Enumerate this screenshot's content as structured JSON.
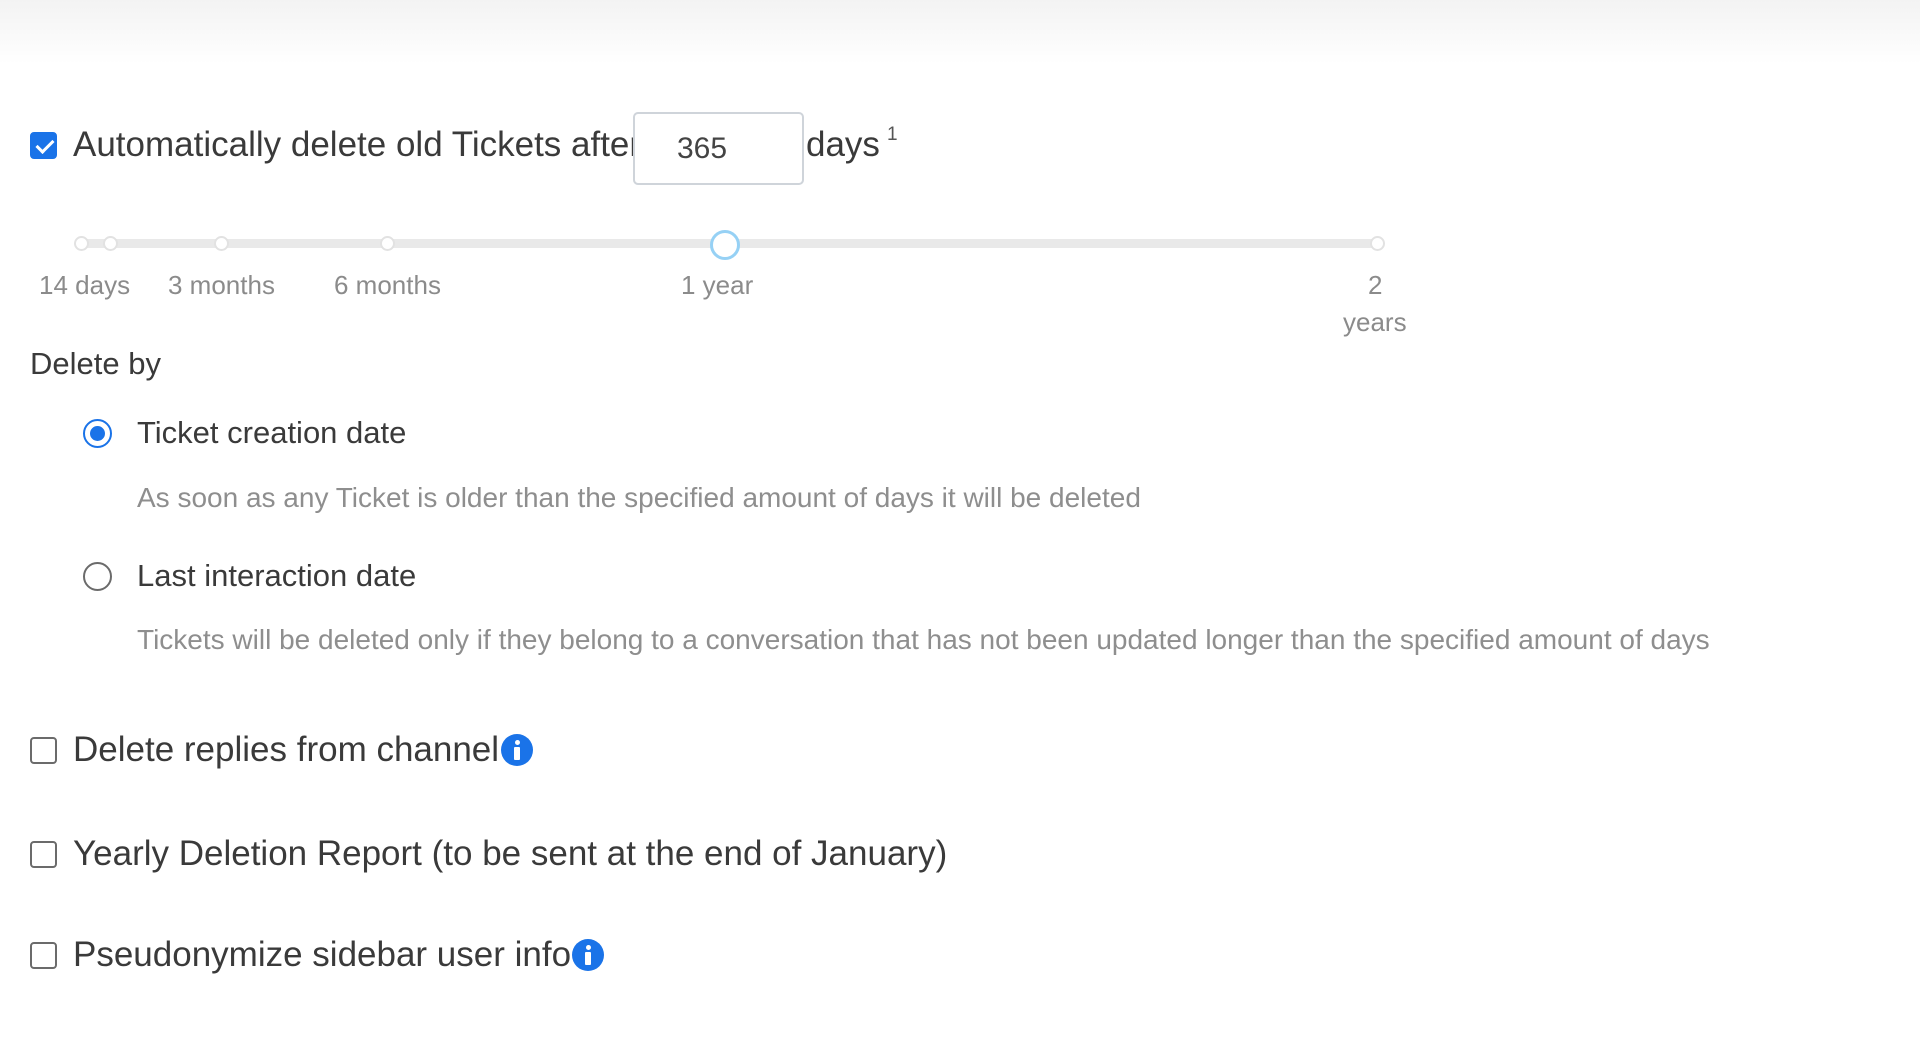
{
  "retention": {
    "enabled": true,
    "label_before": "Automatically delete old Tickets after",
    "days_value": "365",
    "label_after": "days",
    "footnote": "1"
  },
  "slider": {
    "ticks": [
      "14 days",
      "3 months",
      "6 months",
      "1 year",
      "2",
      "years"
    ],
    "selected": "1 year"
  },
  "delete_by": {
    "label": "Delete by",
    "options": [
      {
        "label": "Ticket creation date",
        "description": "As soon as any Ticket is older than the specified amount of days it will be deleted",
        "selected": true
      },
      {
        "label": "Last interaction date",
        "description": "Tickets will be deleted only if they belong to a conversation that has not been updated longer than the specified amount of days",
        "selected": false
      }
    ]
  },
  "options": [
    {
      "label": "Delete replies from channel",
      "checked": false,
      "has_info": true
    },
    {
      "label": "Yearly Deletion Report (to be sent at the end of January)",
      "checked": false,
      "has_info": false
    },
    {
      "label": "Pseudonymize sidebar user info",
      "checked": false,
      "has_info": true
    }
  ],
  "icons": {
    "info": "info-icon"
  },
  "colors": {
    "accent": "#1a73e8",
    "slider_handle": "#96d1f5",
    "help_text": "#8e8e8e"
  }
}
